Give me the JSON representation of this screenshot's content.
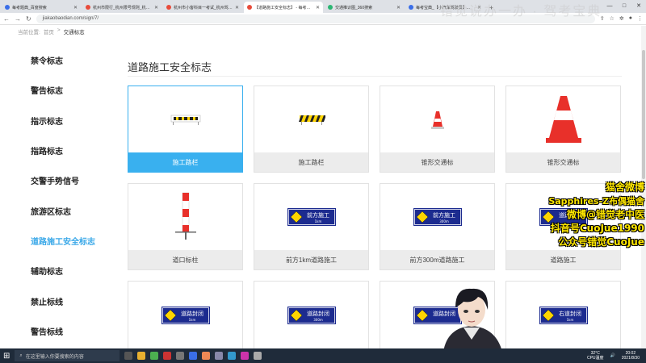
{
  "browser": {
    "tabs": [
      {
        "label": "每考题典_百度搜索",
        "color": "#3a6ee8",
        "active": false
      },
      {
        "label": "杭州市限行_杭州限号规则_杭州...",
        "color": "#e84b3a",
        "active": false
      },
      {
        "label": "杭州市小客科目一考试_杭州驾驶...",
        "color": "#e84b3a",
        "active": false
      },
      {
        "label": "【道路施工安全标志】 - 每考宝典",
        "color": "#e84b3a",
        "active": true
      },
      {
        "label": "交通推识图_360搜索",
        "color": "#2bb673",
        "active": false
      },
      {
        "label": "每考宝典_【小汽车驾驶员】...",
        "color": "#3a6ee8",
        "active": false
      }
    ],
    "new_tab": "+",
    "url": "jiakaobaodian.com/sign/7/",
    "window_controls": [
      "—",
      "□",
      "✕"
    ]
  },
  "breadcrumb": {
    "prefix": "当前位置:",
    "home": "首页",
    "sep": ">",
    "current": "交通标志"
  },
  "sidebar": {
    "items": [
      {
        "label": "禁令标志"
      },
      {
        "label": "警告标志"
      },
      {
        "label": "指示标志"
      },
      {
        "label": "指路标志"
      },
      {
        "label": "交警手势信号"
      },
      {
        "label": "旅游区标志"
      },
      {
        "label": "道路施工安全标志",
        "active": true
      },
      {
        "label": "辅助标志"
      },
      {
        "label": "禁止标线"
      },
      {
        "label": "警告标线"
      }
    ]
  },
  "main": {
    "title": "道路施工安全标志",
    "cards": [
      {
        "caption": "施工路栏",
        "icon": "barrier-white-icon",
        "selected": true
      },
      {
        "caption": "施工路栏",
        "icon": "barrier-yellow-icon",
        "selected": false
      },
      {
        "caption": "锥形交通标",
        "icon": "small-cone-icon",
        "selected": false
      },
      {
        "caption": "锥形交通标",
        "icon": "large-cone-icon",
        "selected": false
      },
      {
        "caption": "道口标柱",
        "icon": "crossing-post-icon",
        "selected": false
      },
      {
        "caption": "前方1km道路施工",
        "icon": "construction-ahead-sign-icon",
        "sign": "前方施工",
        "sub": "1km",
        "selected": false
      },
      {
        "caption": "前方300m道路施工",
        "icon": "construction-ahead-sign-icon",
        "sign": "前方施工",
        "sub": "300m",
        "selected": false
      },
      {
        "caption": "道路施工",
        "icon": "construction-sign-icon",
        "sign": "道路施工",
        "sub": "",
        "selected": false
      },
      {
        "caption": "",
        "icon": "road-closed-sign-icon",
        "sign": "道路封闭",
        "sub": "1km",
        "partial": true
      },
      {
        "caption": "",
        "icon": "road-closed-sign-icon",
        "sign": "道路封闭",
        "sub": "300m",
        "partial": true
      },
      {
        "caption": "",
        "icon": "road-closed-sign-icon",
        "sign": "道路封闭",
        "sub": "",
        "partial": true
      },
      {
        "caption": "",
        "icon": "right-lane-closed-sign-icon",
        "sign": "右道封闭",
        "sub": "1km",
        "partial": true
      }
    ]
  },
  "overlay": {
    "lines": [
      "猫舍微博",
      "Sapphires-Z布偶猫舍",
      "微博@错觉老中医",
      "抖音号CuoJue1990",
      "公众号错觉CuoJue"
    ]
  },
  "watermark": "错觉说办一办 · 驾考宝典",
  "taskbar": {
    "search_placeholder": "在这里输入你要搜索的内容",
    "weather": "32°C",
    "cpu": "CPU温度",
    "time": "20:02",
    "date": "2021/8/30"
  },
  "colors": {
    "accent": "#39b0ef",
    "sign_blue": "#1c2b8f",
    "sign_yellow": "#ffd400",
    "cone_red": "#e8302a"
  }
}
